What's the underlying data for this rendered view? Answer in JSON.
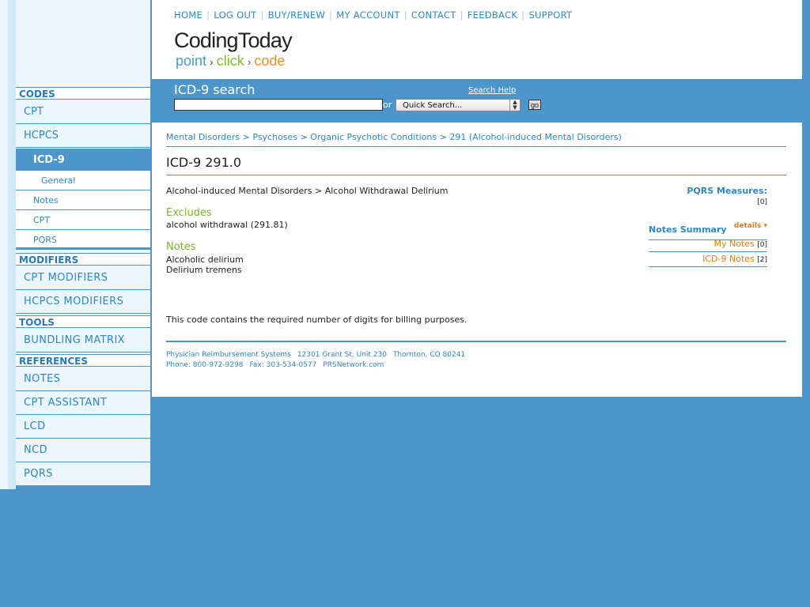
{
  "topnav": {
    "home": "HOME",
    "logout": "LOG OUT",
    "buy": "BUY/RENEW",
    "account": "MY ACCOUNT",
    "contact": "CONTACT",
    "feedback": "FEEDBACK",
    "support": "SUPPORT",
    "separator": "|"
  },
  "logo": {
    "title": "CodingToday",
    "tag_point": "point",
    "tag_click": "click",
    "tag_code": "code",
    "arrow": "›"
  },
  "search": {
    "title": "ICD-9 search",
    "help": "Search Help",
    "or": "or",
    "input_value": "",
    "quick_select": "Quick Search...",
    "go": "go"
  },
  "sidebar": {
    "codes_header": "CODES",
    "cpt": "CPT",
    "hcpcs": "HCPCS",
    "icd9": "ICD-9",
    "general": "General",
    "notes": "Notes",
    "cpt_sub": "CPT",
    "pqrs_sub": "PQRS",
    "modifiers_header": "MODIFIERS",
    "cpt_modifiers": "CPT MODIFIERS",
    "hcpcs_modifiers": "HCPCS MODIFIERS",
    "tools_header": "TOOLS",
    "bundling": "BUNDLING MATRIX",
    "references_header": "REFERENCES",
    "ref_notes": "NOTES",
    "cpt_assistant": "CPT ASSISTANT",
    "lcd": "LCD",
    "ncd": "NCD",
    "pqrs": "PQRS"
  },
  "breadcrumb": {
    "c1": "Mental Disorders",
    "c2": "Psychoses",
    "c3": "Organic Psychotic Conditions",
    "c4": "291 (Alcohol-induced Mental Disorders)",
    "sep": ">"
  },
  "code": {
    "title": "ICD-9 291.0",
    "path": "Alcohol-induced Mental Disorders > Alcohol Withdrawal Delirium",
    "pqrs_label": "PQRS Measures:",
    "pqrs_count": "[0]",
    "excludes_heading": "Excludes",
    "excludes_text": "alcohol withdrawal (291.81)",
    "notes_heading": "Notes",
    "note_1": "Alcoholic delirium",
    "note_2": "Delirium tremens",
    "billing": "This code contains the required number of digits for billing purposes."
  },
  "notes_summary": {
    "title": "Notes Summary",
    "details": "details",
    "my_notes": "My Notes",
    "my_notes_count": "[0]",
    "icd_notes": "ICD-9 Notes",
    "icd_notes_count": "[2]"
  },
  "footer": {
    "company": "Physician Reimbursement Systems",
    "street": "12301 Grant St, Unit 230",
    "city": "Thornton, CO 80241",
    "phone": "Phone: 800-972-9298",
    "fax": "Fax: 303-534-0577",
    "site": "PRSNetwork.com"
  },
  "colors": {
    "brand_blue": "#4d96cb",
    "link_blue": "#2f86c3",
    "green": "#77b52a",
    "orange": "#e07b1a",
    "sidebar_bg": "#eaf6fb"
  }
}
